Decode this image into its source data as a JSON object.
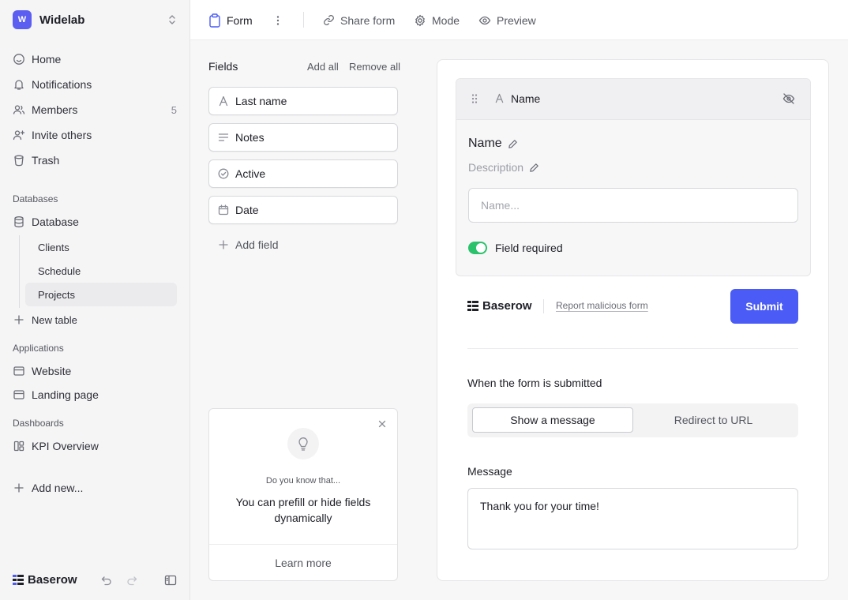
{
  "workspace": {
    "initial": "W",
    "name": "Widelab"
  },
  "nav": {
    "home": "Home",
    "notifications": "Notifications",
    "members": "Members",
    "members_count": "5",
    "invite": "Invite others",
    "trash": "Trash"
  },
  "databases": {
    "section": "Databases",
    "database": "Database",
    "tables": [
      "Clients",
      "Schedule",
      "Projects"
    ],
    "active_table": "Projects",
    "new_table": "New table"
  },
  "applications": {
    "section": "Applications",
    "items": [
      "Website",
      "Landing page"
    ]
  },
  "dashboards": {
    "section": "Dashboards",
    "items": [
      "KPI Overview"
    ]
  },
  "add_new": "Add new...",
  "brand": "Baserow",
  "topbar": {
    "view_name": "Form",
    "share": "Share form",
    "mode": "Mode",
    "preview": "Preview"
  },
  "fields": {
    "title": "Fields",
    "add_all": "Add all",
    "remove_all": "Remove all",
    "items": [
      {
        "label": "Last name",
        "icon": "text-icon"
      },
      {
        "label": "Notes",
        "icon": "long-text-icon"
      },
      {
        "label": "Active",
        "icon": "boolean-icon"
      },
      {
        "label": "Date",
        "icon": "calendar-icon"
      }
    ],
    "add_field": "Add field"
  },
  "tip": {
    "eyebrow": "Do you know that...",
    "text": "You can prefill or hide fields dynamically",
    "learn_more": "Learn more"
  },
  "form": {
    "field_header": "Name",
    "field_name": "Name",
    "description_placeholder": "Description",
    "input_placeholder": "Name...",
    "required_label": "Field required",
    "required": true,
    "report": "Report malicious form",
    "submit": "Submit",
    "when_submitted": "When the form is submitted",
    "options": [
      "Show a message",
      "Redirect to URL"
    ],
    "selected_option": "Show a message",
    "message_label": "Message",
    "message_value": "Thank you for your time!"
  },
  "colors": {
    "accent": "#4a5cf5",
    "workspace_badge": "#5b5ef0",
    "toggle_on": "#2ac26b"
  }
}
